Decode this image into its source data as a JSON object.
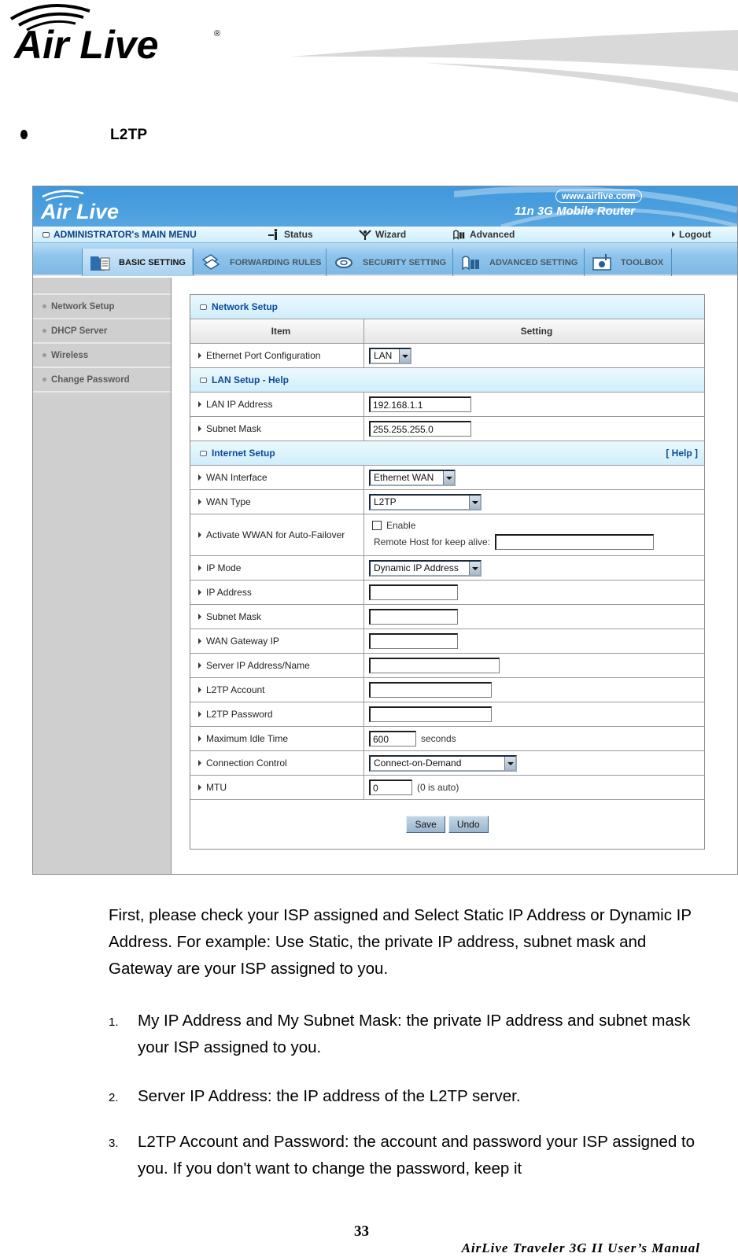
{
  "brand": {
    "name": "Air Live",
    "icon": "airlive-logo"
  },
  "section": {
    "bullet": "•",
    "title": "L2TP"
  },
  "router_ui": {
    "banner": {
      "url": "www.airlive.com",
      "product": "11n 3G Mobile Router",
      "logo": "Air Live"
    },
    "main_menu": {
      "title": "ADMINISTRATOR's MAIN MENU",
      "items": [
        {
          "label": "Status",
          "icon": "status-icon"
        },
        {
          "label": "Wizard",
          "icon": "wizard-icon"
        },
        {
          "label": "Advanced",
          "icon": "advanced-icon"
        },
        {
          "label": "Logout",
          "icon": "arrow-right-icon"
        }
      ]
    },
    "tabs": [
      {
        "label": "BASIC SETTING",
        "icon": "folder-icon",
        "active": true
      },
      {
        "label": "FORWARDING RULES",
        "icon": "forwarding-icon",
        "active": false
      },
      {
        "label": "SECURITY SETTING",
        "icon": "security-icon",
        "active": false
      },
      {
        "label": "ADVANCED SETTING",
        "icon": "advanced-setting-icon",
        "active": false
      },
      {
        "label": "TOOLBOX",
        "icon": "toolbox-icon",
        "active": false
      }
    ],
    "sidebar": {
      "items": [
        {
          "label": "Network Setup"
        },
        {
          "label": "DHCP Server"
        },
        {
          "label": "Wireless"
        },
        {
          "label": "Change Password"
        }
      ]
    },
    "panel": {
      "network_setup_title": "Network Setup",
      "col_item": "Item",
      "col_setting": "Setting",
      "ethernet_port": {
        "label": "Ethernet Port Configuration",
        "value": "LAN"
      },
      "lan_setup_title": "LAN Setup - Help",
      "lan_ip": {
        "label": "LAN IP Address",
        "value": "192.168.1.1"
      },
      "lan_mask": {
        "label": "Subnet Mask",
        "value": "255.255.255.0"
      },
      "internet_setup_title": "Internet Setup",
      "help_link": "[ Help ]",
      "wan_interface": {
        "label": "WAN Interface",
        "value": "Ethernet WAN"
      },
      "wan_type": {
        "label": "WAN Type",
        "value": "L2TP"
      },
      "failover": {
        "label": "Activate WWAN for Auto-Failover",
        "enable_label": "Enable",
        "enabled": false,
        "remote_host_label": "Remote Host for keep alive:",
        "remote_host_value": ""
      },
      "ip_mode": {
        "label": "IP Mode",
        "value": "Dynamic IP Address"
      },
      "ip_address": {
        "label": "IP Address",
        "value": ""
      },
      "subnet_mask": {
        "label": "Subnet Mask",
        "value": ""
      },
      "gateway": {
        "label": "WAN Gateway IP",
        "value": ""
      },
      "server": {
        "label": "Server IP Address/Name",
        "value": ""
      },
      "account": {
        "label": "L2TP Account",
        "value": ""
      },
      "password": {
        "label": "L2TP Password",
        "value": ""
      },
      "idle_time": {
        "label": "Maximum Idle Time",
        "value": "600",
        "unit": "seconds"
      },
      "connection": {
        "label": "Connection Control",
        "value": "Connect-on-Demand"
      },
      "mtu": {
        "label": "MTU",
        "value": "0",
        "note": "(0 is auto)"
      },
      "save_label": "Save",
      "undo_label": "Undo"
    }
  },
  "body": {
    "intro": "First, please check your ISP assigned and Select Static IP Address or Dynamic IP Address. For example: Use Static, the private IP address, subnet mask and Gateway are your ISP assigned to you.",
    "list": [
      {
        "num": "1.",
        "text": "My IP Address and My Subnet Mask: the private IP address and subnet mask your ISP assigned to you."
      },
      {
        "num": "2.",
        "text": "Server IP Address: the IP address of the L2TP server."
      },
      {
        "num": "3.",
        "text": "L2TP Account and Password: the account and password your ISP assigned to you. If you don't want to change the password, keep it"
      }
    ]
  },
  "footer": {
    "page_number": "33",
    "manual_title": "AirLive Traveler 3G II User’s Manual"
  }
}
